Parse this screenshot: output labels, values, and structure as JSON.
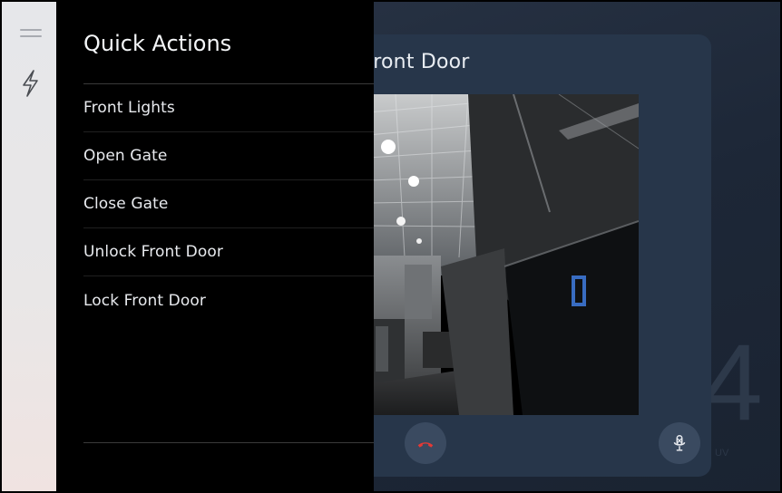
{
  "intercom": {
    "title": "Front Door"
  },
  "background": {
    "digit": "4",
    "digit_sub": "UV"
  },
  "quick_actions": {
    "title": "Quick Actions",
    "items": [
      {
        "label": "Front Lights"
      },
      {
        "label": "Open Gate"
      },
      {
        "label": "Close Gate"
      },
      {
        "label": "Unlock Front Door"
      },
      {
        "label": "Lock Front Door"
      }
    ]
  },
  "icons": {
    "menu": "hamburger-menu-icon",
    "actions": "lightning-bolt-icon",
    "hangup": "phone-hangup-icon",
    "mute": "microphone-mute-icon"
  },
  "colors": {
    "accent": "#2196f3",
    "hangup": "#e53935",
    "panel_bg": "#000000",
    "rail_bg": "#e6e7ea",
    "card_bg": "#27364a"
  }
}
